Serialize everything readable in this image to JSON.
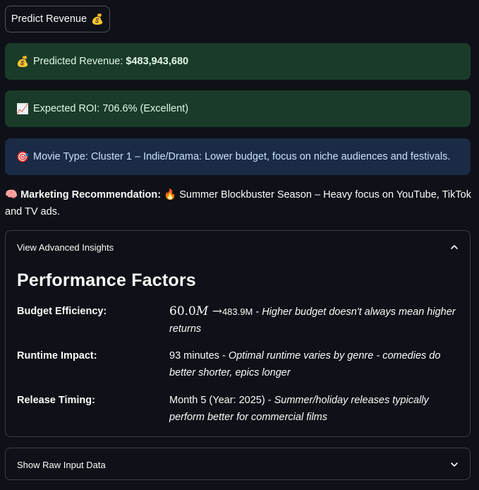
{
  "predict_button": {
    "label": "Predict Revenue",
    "icon": "money-bag-icon",
    "emoji": "💰"
  },
  "alerts": {
    "revenue": {
      "emoji": "💰",
      "prefix": "Predicted Revenue: ",
      "value": "$483,943,680"
    },
    "roi": {
      "emoji": "📈",
      "text": "Expected ROI: 706.6% (Excellent)"
    },
    "movie_type": {
      "emoji": "🎯",
      "text": "Movie Type: Cluster 1 – Indie/Drama: Lower budget, focus on niche audiences and festivals."
    }
  },
  "marketing": {
    "emoji": "🧠",
    "label": "Marketing Recommendation:",
    "fire_emoji": "🔥",
    "text": "Summer Blockbuster Season – Heavy focus on YouTube, TikTok and TV ads."
  },
  "advanced_insights": {
    "title": "View Advanced Insights",
    "expanded": true,
    "heading": "Performance Factors",
    "rows": [
      {
        "label": "Budget Efficiency:",
        "math_number": "60.0",
        "math_unit": "M",
        "math_arrow": "→",
        "value": "483.9M",
        "sep": " - ",
        "note": "Higher budget doesn't always mean higher returns"
      },
      {
        "label": "Runtime Impact:",
        "value": "93 minutes",
        "sep": " - ",
        "note": "Optimal runtime varies by genre - comedies do better shorter, epics longer"
      },
      {
        "label": "Release Timing:",
        "value": "Month 5 (Year: 2025)",
        "sep": " - ",
        "note": "Summer/holiday releases typically perform better for commercial films"
      }
    ]
  },
  "raw_input": {
    "title": "Show Raw Input Data",
    "expanded": false
  },
  "colors": {
    "background": "#0e1117",
    "success_bg": "#1b3b2a",
    "info_bg": "#1b2b45",
    "text": "#fafafa"
  }
}
